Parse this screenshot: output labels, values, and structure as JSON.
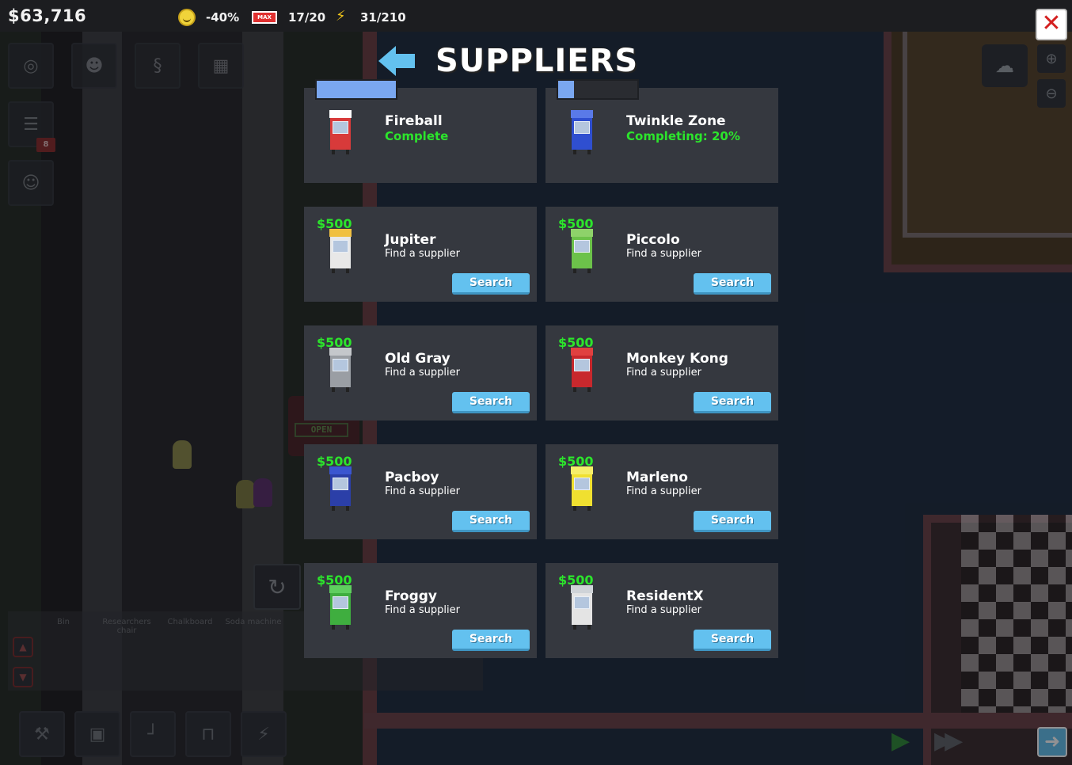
{
  "hud": {
    "money": "$63,716",
    "mood": "-40%",
    "capacity_icon": "MAX",
    "capacity": "17/20",
    "power": "31/210"
  },
  "overlay": {
    "title": "SUPPLIERS",
    "back_icon": "back-arrow-icon",
    "close_icon": "close-icon"
  },
  "suppliers": [
    {
      "name": "Fireball",
      "status": "Complete",
      "price": "",
      "state": "owned",
      "progress": 1.0,
      "body_color": "#d83a3a",
      "top_color": "#ffffff"
    },
    {
      "name": "Twinkle Zone",
      "status": "Completing: 20%",
      "price": "",
      "state": "researching",
      "progress": 0.2,
      "body_color": "#2f4fd0",
      "top_color": "#5a7ae8"
    },
    {
      "name": "Jupiter",
      "status": "Find a supplier",
      "price": "$500",
      "state": "available",
      "button": "Search",
      "body_color": "#e8e8e8",
      "top_color": "#f0c040"
    },
    {
      "name": "Piccolo",
      "status": "Find a supplier",
      "price": "$500",
      "state": "available",
      "button": "Search",
      "body_color": "#6cc24a",
      "top_color": "#8ed26a"
    },
    {
      "name": "Old Gray",
      "status": "Find a supplier",
      "price": "$500",
      "state": "available",
      "button": "Search",
      "body_color": "#9a9ea4",
      "top_color": "#c4c7cb"
    },
    {
      "name": "Monkey Kong",
      "status": "Find a supplier",
      "price": "$500",
      "state": "available",
      "button": "Search",
      "body_color": "#c8282d",
      "top_color": "#e04040"
    },
    {
      "name": "Pacboy",
      "status": "Find a supplier",
      "price": "$500",
      "state": "available",
      "button": "Search",
      "body_color": "#2b3fa8",
      "top_color": "#3b56d0"
    },
    {
      "name": "Marleno",
      "status": "Find a supplier",
      "price": "$500",
      "state": "available",
      "button": "Search",
      "body_color": "#f0e030",
      "top_color": "#f6ee6a"
    },
    {
      "name": "Froggy",
      "status": "Find a supplier",
      "price": "$500",
      "state": "available",
      "button": "Search",
      "body_color": "#3fae3f",
      "top_color": "#5fce5f"
    },
    {
      "name": "ResidentX",
      "status": "Find a supplier",
      "price": "$500",
      "state": "available",
      "button": "Search",
      "body_color": "#e4e4e4",
      "top_color": "#cfd3d8"
    }
  ],
  "background": {
    "shop_sign": "OPEN",
    "build_items": [
      "Bin",
      "Researchers chair",
      "Chalkboard",
      "Soda machine"
    ],
    "notification_count": "8"
  },
  "colors": {
    "price_green": "#2ce52c",
    "button_blue": "#63c1ef",
    "card_bg": "#35383f",
    "close_red": "#d42020"
  }
}
